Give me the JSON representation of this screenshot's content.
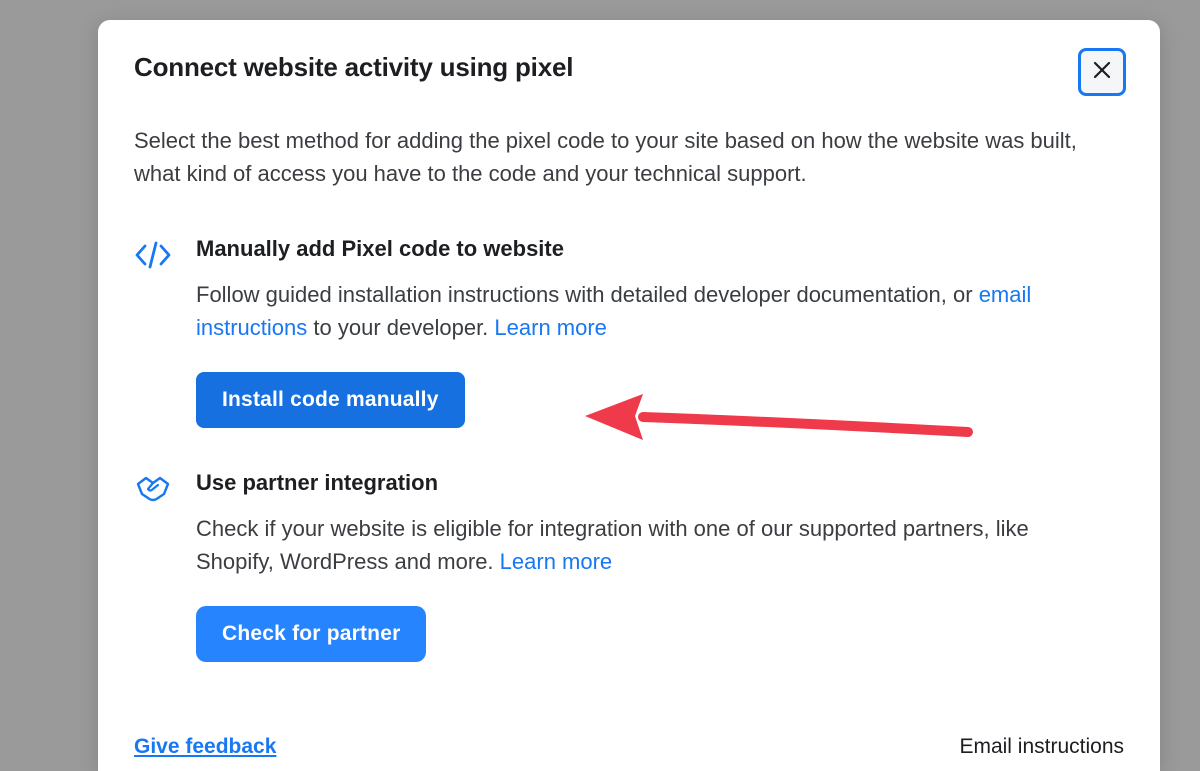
{
  "modal": {
    "title": "Connect website activity using pixel",
    "close_label": "✕",
    "subtitle": "Select the best method for adding the pixel code to your site based on how the website was built, what kind of access you have to the code and your technical support."
  },
  "options": {
    "manual": {
      "title": "Manually add Pixel code to website",
      "desc_prefix": "Follow guided installation instructions with detailed developer documentation, or ",
      "email_link": "email instructions",
      "desc_middle": " to your developer. ",
      "learn_more": "Learn more",
      "button": "Install code manually"
    },
    "partner": {
      "title": "Use partner integration",
      "desc_prefix": "Check if your website is eligible for integration with one of our supported partners, like Shopify, WordPress and more. ",
      "learn_more": "Learn more",
      "button": "Check for partner"
    }
  },
  "footer": {
    "feedback": "Give feedback",
    "email_instructions": "Email instructions"
  },
  "colors": {
    "primary": "#1877f2",
    "button_primary": "#1670e0",
    "button_secondary": "#2684ff",
    "text": "#1c1e21",
    "annotation": "#ee3a4a"
  }
}
